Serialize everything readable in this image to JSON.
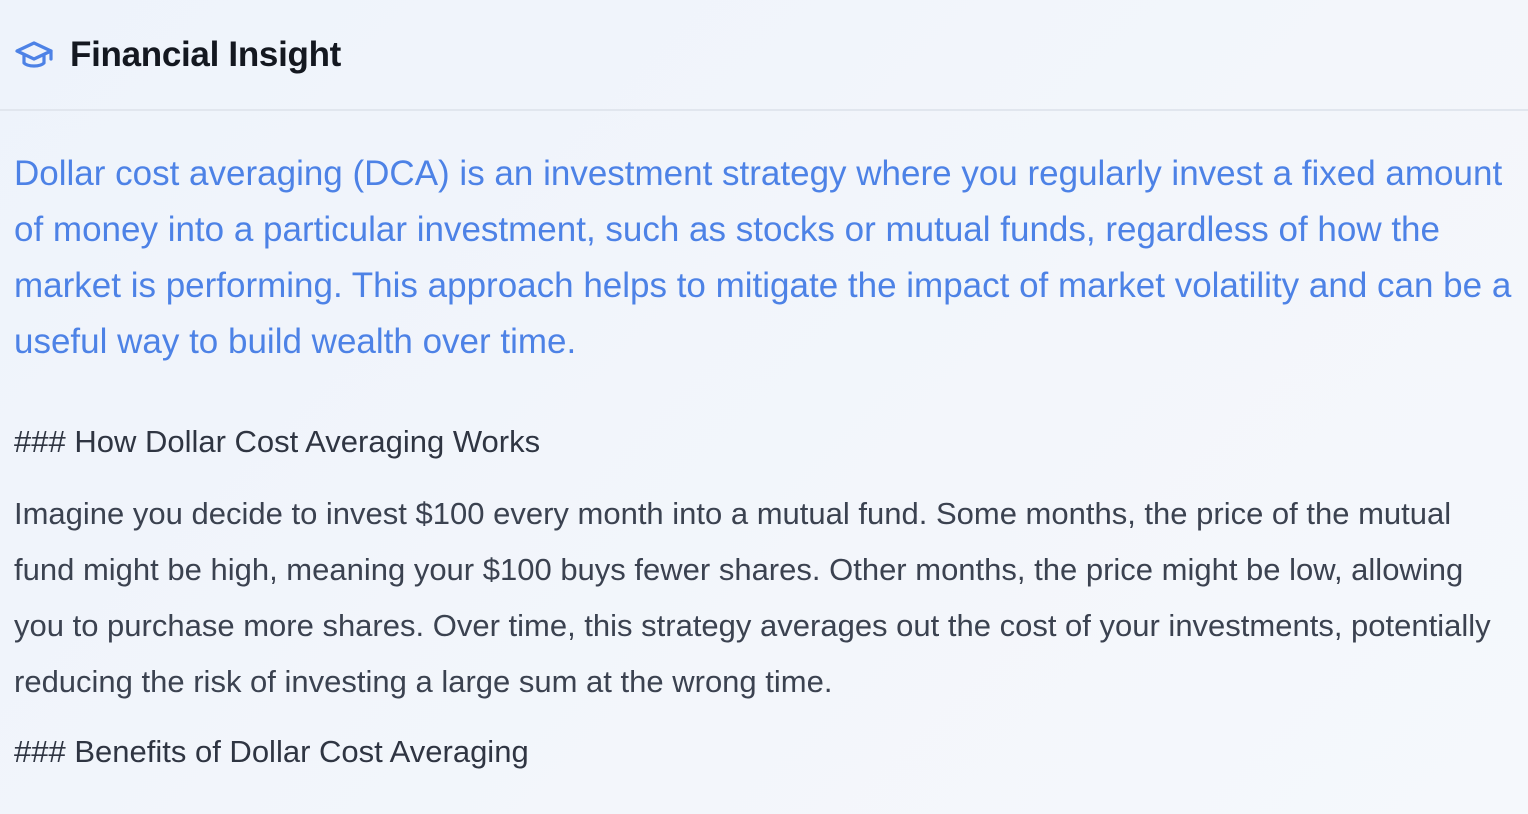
{
  "header": {
    "icon": "graduation-cap-icon",
    "title": "Financial Insight"
  },
  "content": {
    "intro": "Dollar cost averaging (DCA) is an investment strategy where you regularly invest a fixed amount of money into a particular investment, such as stocks or mutual funds, regardless of how the market is performing. This approach helps to mitigate the impact of market volatility and can be a useful way to build wealth over time.",
    "heading_1": "### How Dollar Cost Averaging Works",
    "paragraph_1": "Imagine you decide to invest $100 every month into a mutual fund. Some months, the price of the mutual fund might be high, meaning your $100 buys fewer shares. Other months, the price might be low, allowing you to purchase more shares. Over time, this strategy averages out the cost of your investments, potentially reducing the risk of investing a large sum at the wrong time.",
    "heading_2": "### Benefits of Dollar Cost Averaging"
  },
  "colors": {
    "accent": "#4d82e6",
    "title": "#141820",
    "body_text": "#3b4250",
    "background": "#eef3fb",
    "divider": "#e1e6ee"
  }
}
